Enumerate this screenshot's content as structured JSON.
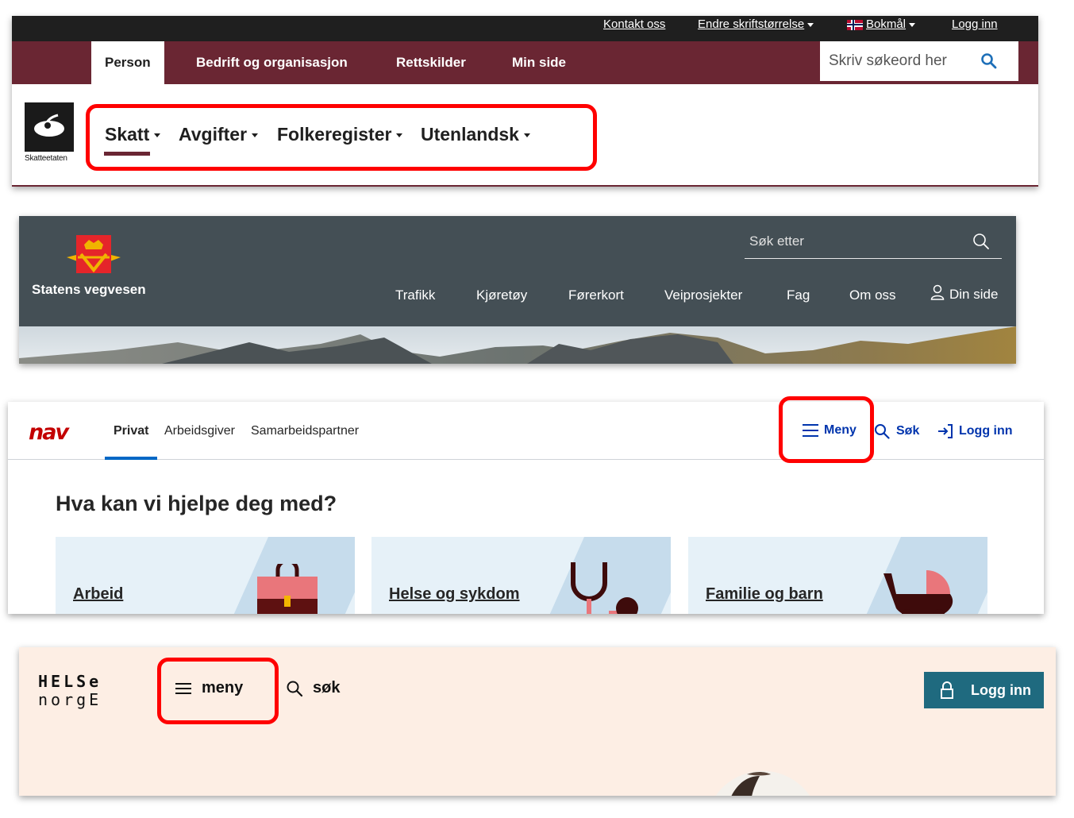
{
  "skatteetaten": {
    "utility_links": [
      "Kontakt oss",
      "Endre skriftstørrelse",
      "Bokmål",
      "Logg inn"
    ],
    "main_nav": [
      "Person",
      "Bedrift og organisasjon",
      "Rettskilder",
      "Min side"
    ],
    "search_placeholder": "Skriv søkeord her",
    "logo_text": "Skatteetaten",
    "sub_nav": [
      "Skatt",
      "Avgifter",
      "Folkeregister",
      "Utenlandsk"
    ],
    "colors": {
      "brand": "#6a2633",
      "topbar": "#1f1f1f",
      "highlight": "#ff0000"
    }
  },
  "vegvesen": {
    "brand": "Statens vegvesen",
    "search_placeholder": "Søk etter",
    "menu": [
      "Trafikk",
      "Kjøretøy",
      "Førerkort",
      "Veiprosjekter",
      "Fag",
      "Om oss",
      "Din side"
    ],
    "colors": {
      "background": "#444f55"
    }
  },
  "nav": {
    "logo": "nav",
    "tabs": [
      "Privat",
      "Arbeidsgiver",
      "Samarbeidspartner"
    ],
    "header_links": {
      "menu": "Meny",
      "search": "Søk",
      "login": "Logg inn"
    },
    "heading": "Hva kan vi hjelpe deg med?",
    "cards": [
      "Arbeid",
      "Helse og sykdom",
      "Familie og barn"
    ],
    "colors": {
      "logo": "#c30000",
      "link": "#0034ad",
      "card": "#e6f1f8"
    }
  },
  "helsenorge": {
    "logo_line1": "HELSe",
    "logo_line2": "norgE",
    "menu": "meny",
    "search": "søk",
    "login": "Logg inn",
    "colors": {
      "background": "#fdeee4",
      "button": "#1f6a7f"
    }
  }
}
